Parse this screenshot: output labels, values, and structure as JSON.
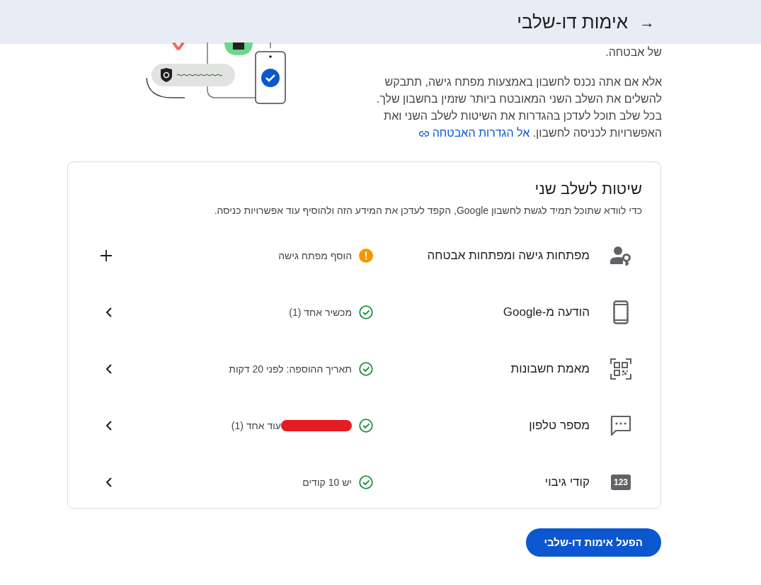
{
  "header": {
    "back_arrow": "→",
    "title": "אימות דו-שלבי"
  },
  "intro": {
    "paragraphs": [
      "של אבטחה.",
      "אלא אם אתה נכנס לחשבון באמצעות מפתח גישה, תתבקש להשלים את השלב השני המאובטח ביותר שזמין בחשבון שלך. בכל שלב תוכל לעדכן בהגדרות את השיטות לשלב השני ואת האפשרויות לכניסה לחשבון."
    ],
    "link": "אל הגדרות האבטחה"
  },
  "methods": {
    "title": "שיטות לשלב שני",
    "subtitle": "כדי לוודא שתוכל תמיד לגשת לחשבון Google, הקפד לעדכן את המידע הזה ולהוסיף עוד אפשרויות כניסה.",
    "rows": [
      {
        "kind": "passkey",
        "label": "מפתחות גישה ומפתחות אבטחה",
        "set_up": false,
        "status_text": "הוסף מפתח גישה",
        "redacted": false
      },
      {
        "kind": "phone",
        "label": "הודעה מ-Google",
        "set_up": true,
        "status_text": "מכשיר אחד (1)",
        "redacted": false
      },
      {
        "kind": "qr",
        "label": "מאמת חשבונות",
        "set_up": true,
        "status_text": "תאריך ההוספה: לפני 20 דקות",
        "redacted": false
      },
      {
        "kind": "message",
        "label": "מספר טלפון",
        "set_up": true,
        "status_text": "עוד אחד (1)",
        "redacted": true
      },
      {
        "kind": "codes",
        "icon_text": "123",
        "label": "קודי גיבוי",
        "set_up": true,
        "status_text": "יש 10 קודים",
        "redacted": false
      }
    ]
  },
  "button": "הפעל אימות דו-שלבי"
}
